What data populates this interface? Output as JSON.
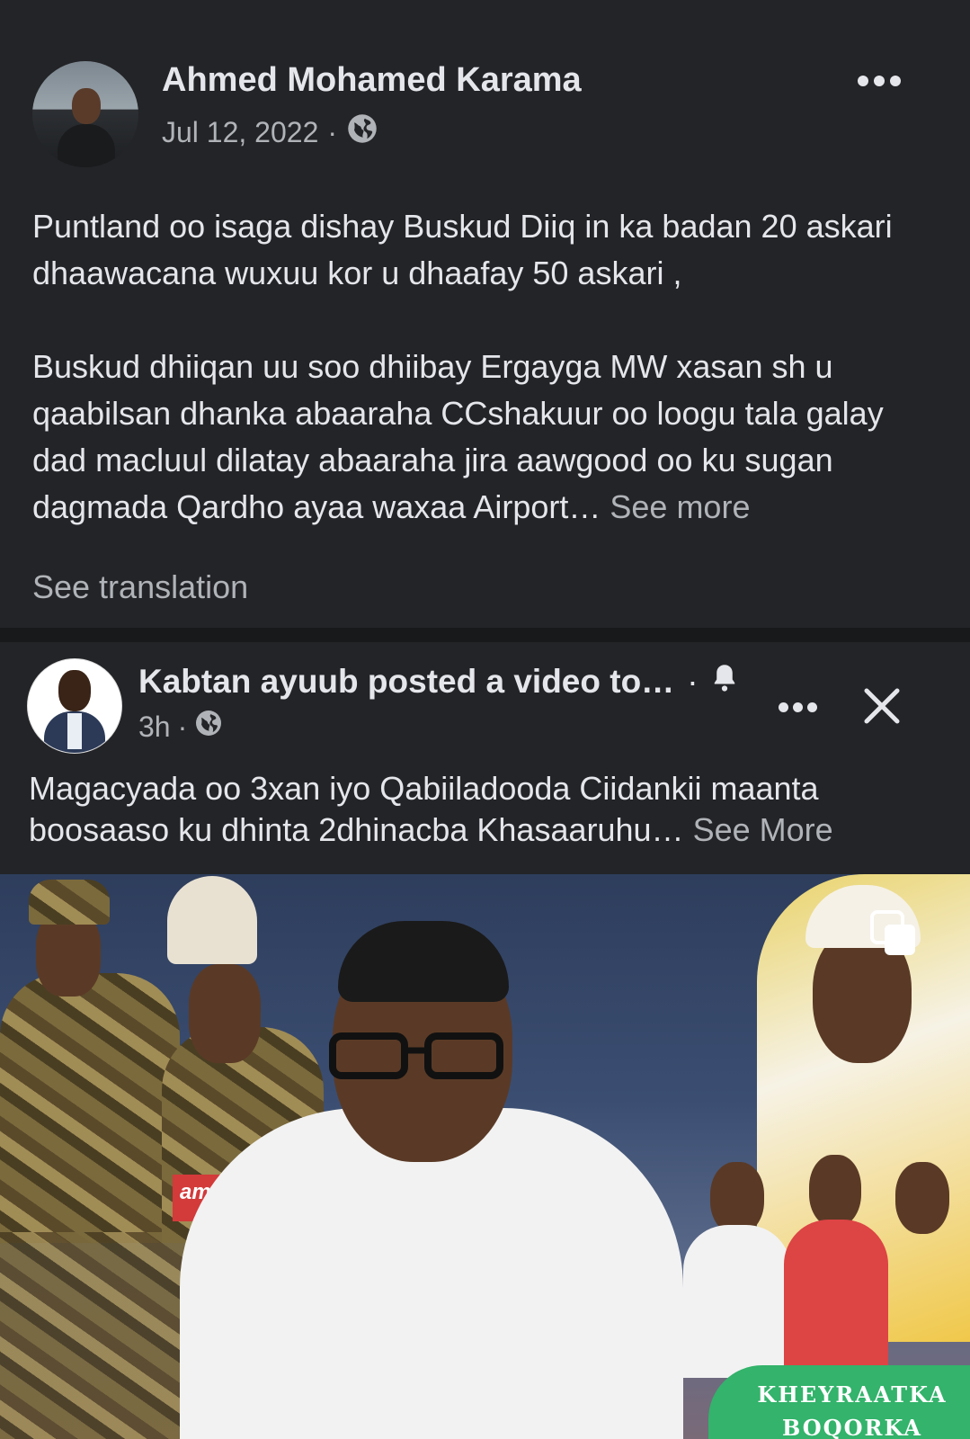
{
  "post1": {
    "author": "Ahmed Mohamed Karama",
    "date": "Jul 12, 2022",
    "separator": "·",
    "privacy_icon": "globe-icon",
    "more_icon": "more-dots-icon",
    "paragraph1": "Puntland oo isaga dishay Buskud Diiq in ka badan 20 askari dhaawacana wuxuu kor u dhaafay 50 askari ,",
    "paragraph2": "Buskud dhiiqan uu soo dhiibay  Ergayga MW xasan sh u qaabilsan dhanka abaaraha CCshakuur oo loogu tala galay dad macluul dilatay abaaraha jira aawgood oo ku sugan dagmada Qardho ayaa waxaa Airport…",
    "see_more": "See more",
    "see_translation": "See translation"
  },
  "post2": {
    "title": "Kabtan ayuub posted a video to…",
    "title_separator": "·",
    "bell_icon": "bell-icon",
    "time": "3h",
    "separator": "·",
    "privacy_icon": "globe-icon",
    "more_icon": "more-dots-icon",
    "close_icon": "close-icon",
    "text": "Magacyada oo 3xan iyo Qabiiladooda Ciidankii maanta boosaaso ku dhinta  2dhinacba Khasaaruhu…",
    "see_more": "See More",
    "thumbnail": {
      "name_card_text": "amud Div",
      "badge_line1": "KHEYRAATKA",
      "badge_line2": "BOQORKA",
      "multi_icon": "multiple-media-icon",
      "badge_color": "#33b36b"
    }
  },
  "colors": {
    "background": "#232427",
    "divider": "#18191b",
    "primary_text": "#e4e6eb",
    "secondary_text": "#b0b3b8"
  }
}
